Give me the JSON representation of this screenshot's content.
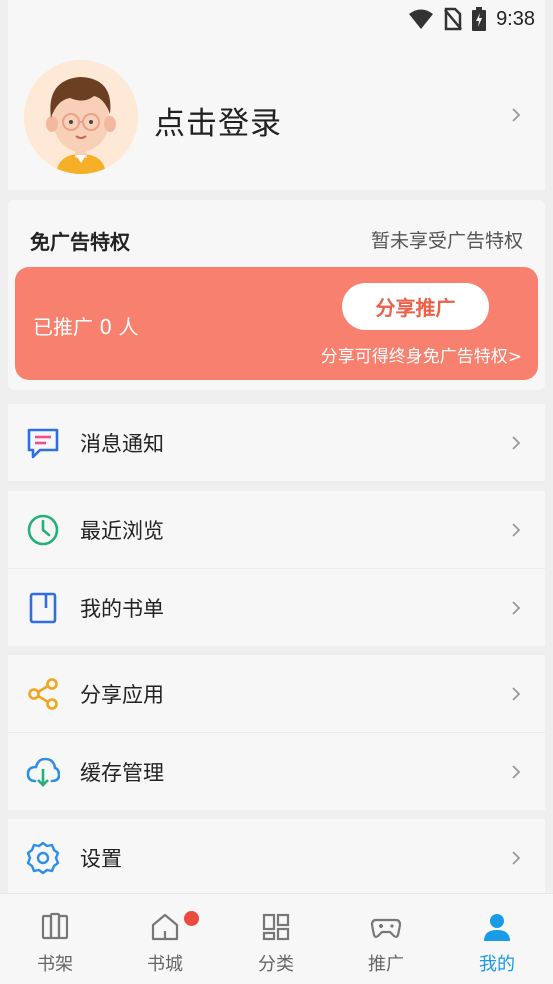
{
  "status_bar": {
    "time": "9:38"
  },
  "profile": {
    "login_label": "点击登录"
  },
  "ad_privilege": {
    "title": "免广告特权",
    "status": "暂未享受广告特权",
    "promoted_count_text": "已推广 0 人",
    "share_button_label": "分享推广",
    "benefit_note": "分享可得终身免广告特权>"
  },
  "menu": {
    "notifications": "消息通知",
    "recent": "最近浏览",
    "booklist": "我的书单",
    "share_app": "分享应用",
    "cache": "缓存管理",
    "settings": "设置"
  },
  "tabs": [
    {
      "label": "书架",
      "icon": "bookshelf-icon"
    },
    {
      "label": "书城",
      "icon": "bookstore-icon"
    },
    {
      "label": "分类",
      "icon": "category-icon"
    },
    {
      "label": "推广",
      "icon": "gamepad-icon"
    },
    {
      "label": "我的",
      "icon": "user-icon"
    }
  ],
  "colors": {
    "accent": "#1a9be6",
    "promo": "#f7806f",
    "badge": "#ea4b3c"
  }
}
